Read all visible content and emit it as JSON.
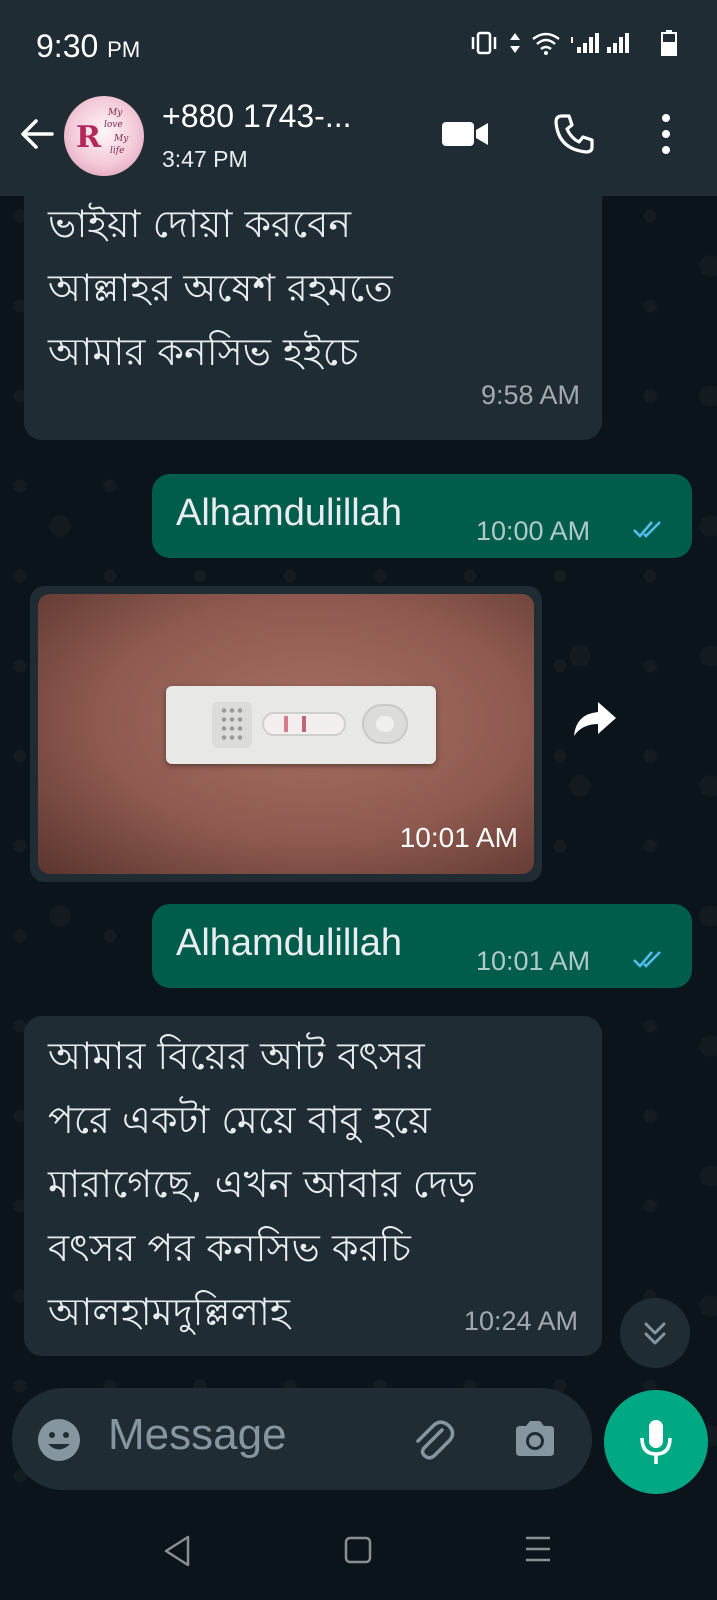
{
  "status_bar": {
    "time": "9:30",
    "ampm": "PM"
  },
  "header": {
    "contact_name": "+880 1743-...",
    "subtitle": "3:47 PM",
    "avatar_text": "R",
    "avatar_script": [
      "My",
      "love",
      "My",
      "life"
    ]
  },
  "messages": [
    {
      "direction": "incoming",
      "text": "ভাইয়া দোয়া করবেন\nআল্লাহর অষেশ রহমতে\nআমার কনসিভ হইচে",
      "time": "9:58 AM"
    },
    {
      "direction": "outgoing",
      "text": "Alhamdulillah",
      "time": "10:00 AM",
      "status": "read"
    },
    {
      "direction": "incoming",
      "type": "image",
      "time": "10:01 AM"
    },
    {
      "direction": "outgoing",
      "text": "Alhamdulillah",
      "time": "10:01 AM",
      "status": "read"
    },
    {
      "direction": "incoming",
      "text": "আমার বিয়ের আট বৎসর\nপরে একটা মেয়ে বাবু হয়ে\nমারাগেছে, এখন আবার দেড়\nবৎসর পর কনসিভ করচি\nআলহামদুল্লিলাহ",
      "time": "10:24 AM"
    }
  ],
  "composer": {
    "placeholder": "Message"
  },
  "colors": {
    "header_bg": "#1f2c34",
    "chat_bg": "#0b141a",
    "incoming_bubble": "#1f2c34",
    "outgoing_bubble": "#005c4b",
    "accent": "#00a884",
    "read_ticks": "#53bdeb"
  },
  "icons": [
    "back-arrow-icon",
    "video-call-icon",
    "phone-icon",
    "more-vert-icon",
    "forward-icon",
    "scroll-down-icon",
    "emoji-icon",
    "attach-icon",
    "camera-icon",
    "mic-icon"
  ]
}
